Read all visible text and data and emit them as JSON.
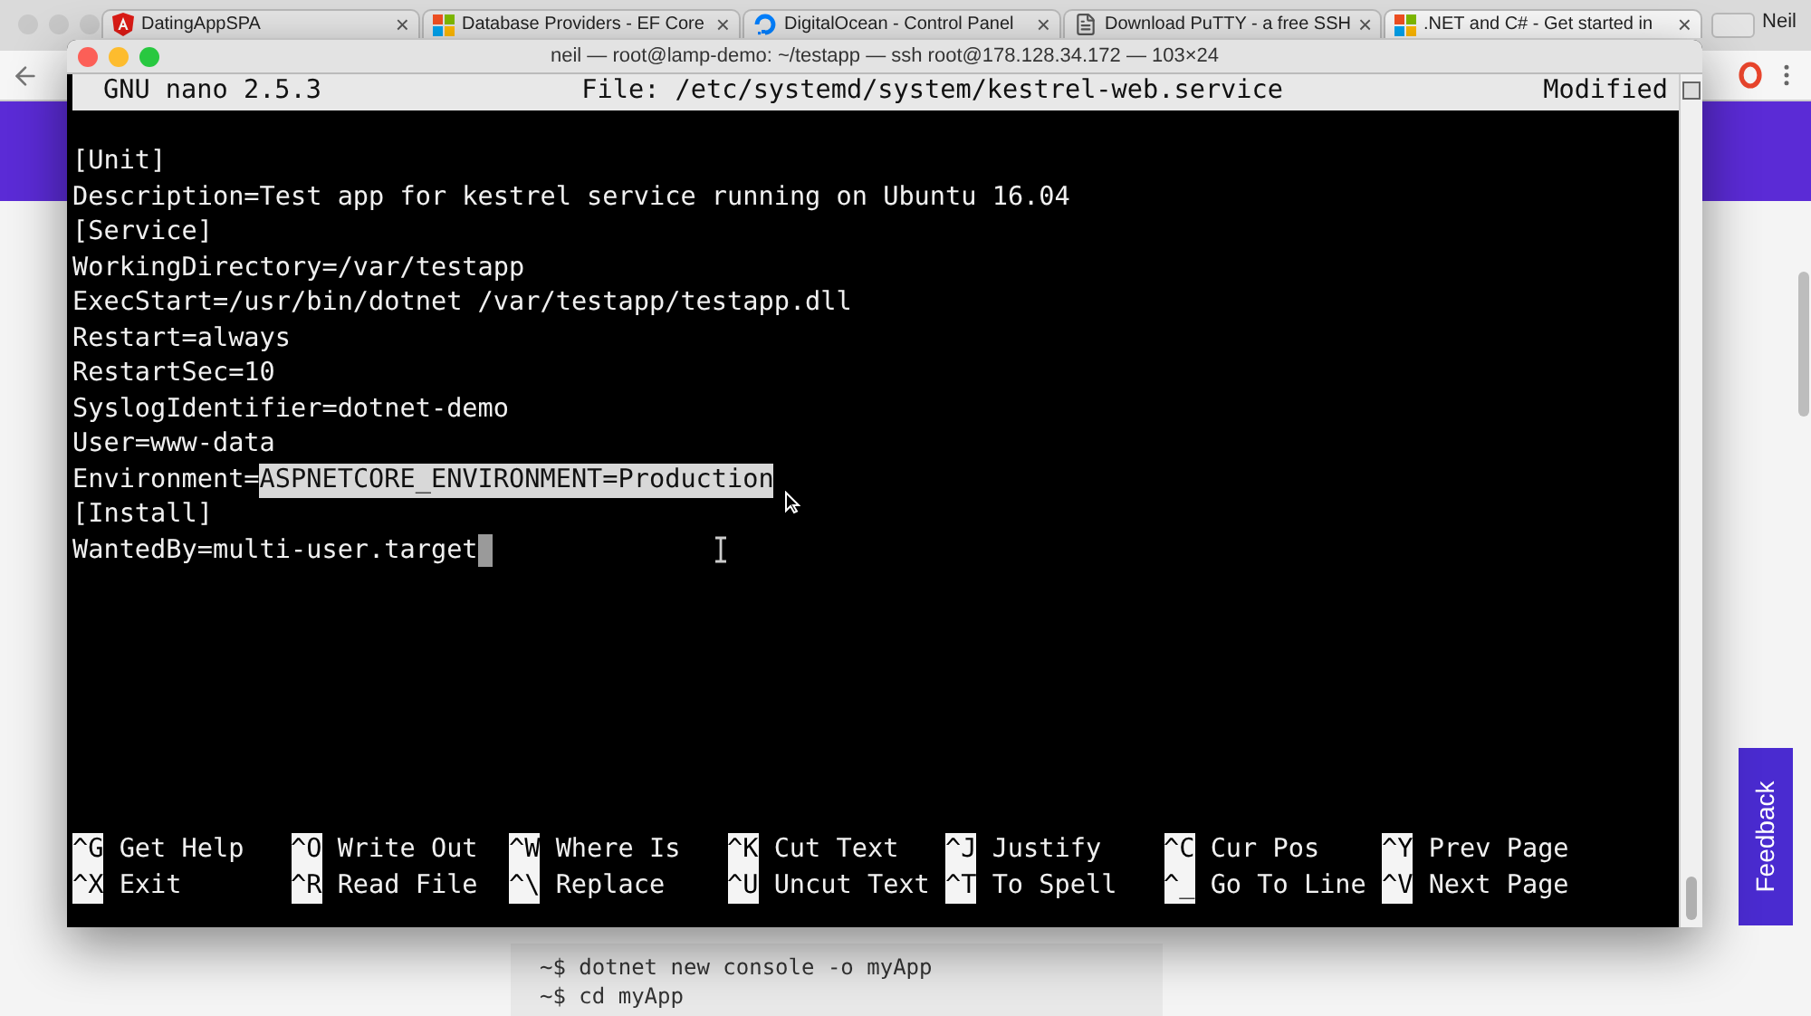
{
  "browser": {
    "tabs": [
      {
        "label": "DatingAppSPA",
        "kind": "shield",
        "selected": false,
        "close": "×"
      },
      {
        "label": "Database Providers - EF Core",
        "kind": "squares",
        "selected": false,
        "close": "×"
      },
      {
        "label": "DigitalOcean - Control Panel",
        "kind": "swirl",
        "selected": false,
        "close": "×"
      },
      {
        "label": "Download PuTTY - a free SSH",
        "kind": "page",
        "selected": false,
        "close": "×"
      },
      {
        "label": ".NET and C# - Get started in",
        "kind": "squares",
        "selected": true,
        "close": "×"
      }
    ],
    "user": "Neil"
  },
  "terminal": {
    "title": "neil — root@lamp-demo: ~/testapp — ssh root@178.128.34.172 — 103×24",
    "header": {
      "app": "GNU nano 2.5.3",
      "file": "File: /etc/systemd/system/kestrel-web.service",
      "status": "Modified"
    },
    "lines": [
      {
        "segments": [
          {
            "text": "[Unit]",
            "selected": false
          }
        ]
      },
      {
        "segments": [
          {
            "text": "Description=Test app for kestrel service running on Ubuntu 16.04",
            "selected": false
          }
        ]
      },
      {
        "segments": [
          {
            "text": "[Service]",
            "selected": false
          }
        ]
      },
      {
        "segments": [
          {
            "text": "WorkingDirectory=/var/testapp",
            "selected": false
          }
        ]
      },
      {
        "segments": [
          {
            "text": "ExecStart=/usr/bin/dotnet /var/testapp/testapp.dll",
            "selected": false
          }
        ]
      },
      {
        "segments": [
          {
            "text": "Restart=always",
            "selected": false
          }
        ]
      },
      {
        "segments": [
          {
            "text": "RestartSec=10",
            "selected": false
          }
        ]
      },
      {
        "segments": [
          {
            "text": "SyslogIdentifier=dotnet-demo",
            "selected": false
          }
        ]
      },
      {
        "segments": [
          {
            "text": "User=www-data",
            "selected": false
          }
        ]
      },
      {
        "segments": [
          {
            "text": "Environment=",
            "selected": false
          },
          {
            "text": "ASPNETCORE_ENVIRONMENT=Production",
            "selected": true
          }
        ]
      },
      {
        "segments": [
          {
            "text": "[Install]",
            "selected": false
          }
        ]
      },
      {
        "segments": [
          {
            "text": "WantedBy=multi-user.target",
            "selected": false
          }
        ],
        "cursor": true
      }
    ],
    "shortcuts": [
      {
        "key": "^G",
        "label": "Get Help"
      },
      {
        "key": "^X",
        "label": "Exit"
      },
      {
        "key": "^O",
        "label": "Write Out"
      },
      {
        "key": "^R",
        "label": "Read File"
      },
      {
        "key": "^W",
        "label": "Where Is"
      },
      {
        "key": "^\\",
        "label": "Replace"
      },
      {
        "key": "^K",
        "label": "Cut Text"
      },
      {
        "key": "^U",
        "label": "Uncut Text"
      },
      {
        "key": "^J",
        "label": "Justify"
      },
      {
        "key": "^T",
        "label": "To Spell"
      },
      {
        "key": "^C",
        "label": "Cur Pos"
      },
      {
        "key": "^_",
        "label": "Go To Line"
      },
      {
        "key": "^Y",
        "label": "Prev Page"
      },
      {
        "key": "^V",
        "label": "Next Page"
      }
    ]
  },
  "page": {
    "feedback": "Feedback",
    "snippet": [
      "~$ dotnet new console -o myApp",
      "~$ cd myApp"
    ]
  }
}
